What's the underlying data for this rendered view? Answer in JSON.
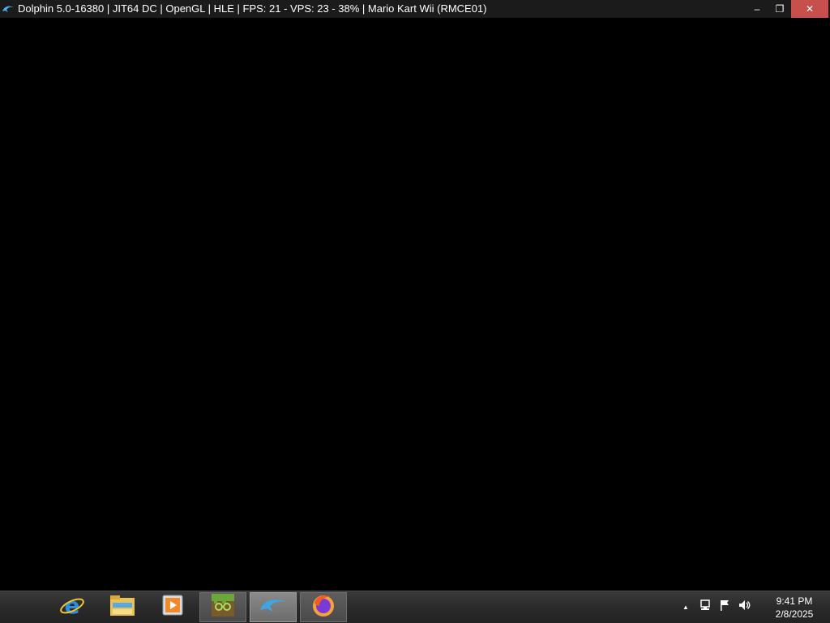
{
  "window": {
    "title": "Dolphin 5.0-16380 | JIT64 DC | OpenGL | HLE | FPS: 21 - VPS: 23 - 38% | Mario Kart Wii (RMCE01)",
    "icon": "dolphin-icon",
    "controls": {
      "minimize": "–",
      "restore": "❐",
      "close": "✕"
    },
    "close_color": "#c7504c"
  },
  "taskbar": {
    "apps": [
      {
        "name": "internet-explorer-icon",
        "state": "pinned"
      },
      {
        "name": "file-explorer-icon",
        "state": "pinned"
      },
      {
        "name": "media-player-icon",
        "state": "pinned"
      },
      {
        "name": "minecraft-launcher-icon",
        "state": "running"
      },
      {
        "name": "dolphin-icon",
        "state": "active"
      },
      {
        "name": "firefox-icon",
        "state": "running"
      }
    ],
    "tray": {
      "icons": [
        "show-hidden-icons-arrow-icon",
        "network-icon",
        "action-center-flag-icon",
        "volume-icon"
      ],
      "arrow": "▲"
    },
    "clock": {
      "time": "9:41 PM",
      "date": "2/8/2025"
    }
  }
}
